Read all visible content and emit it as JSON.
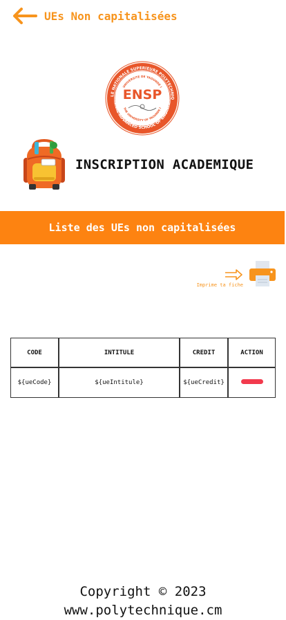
{
  "header": {
    "title": "UEs Non capitalisées",
    "back_icon": "arrow-left-icon",
    "accent_color": "#f7941d"
  },
  "logo": {
    "center_text": "ENSP",
    "ring_top": "ECOLE NATIONALE SUPERIEURE POLYTECHNIQUE",
    "ring_inner_top": "UNIVERSITE DE YAOUNDE I",
    "ring_bottom": "NATIONAL ADVANCED SCHOOL OF ENGINEERING",
    "ring_inner_bottom": "THE UNIVERSITY OF YAOUNDE I"
  },
  "brand": {
    "title": "INSCRIPTION ACADEMIQUE",
    "icon": "backpack-icon"
  },
  "banner": {
    "text": "Liste des UEs non capitalisées",
    "color": "#fd8311"
  },
  "print": {
    "label": "Imprime ta fiche",
    "icon": "printer-icon",
    "arrow_icon": "arrow-right-icon"
  },
  "table": {
    "headers": [
      "CODE",
      "INTITULE",
      "CREDIT",
      "ACTION"
    ],
    "rows": [
      {
        "code": "${ueCode}",
        "intitule": "${ueIntitule}",
        "credit": "${ueCredit}"
      }
    ],
    "action_color": "#f23a4d"
  },
  "footer": {
    "copyright": "Copyright © 2023",
    "website": "www.polytechnique.cm"
  }
}
